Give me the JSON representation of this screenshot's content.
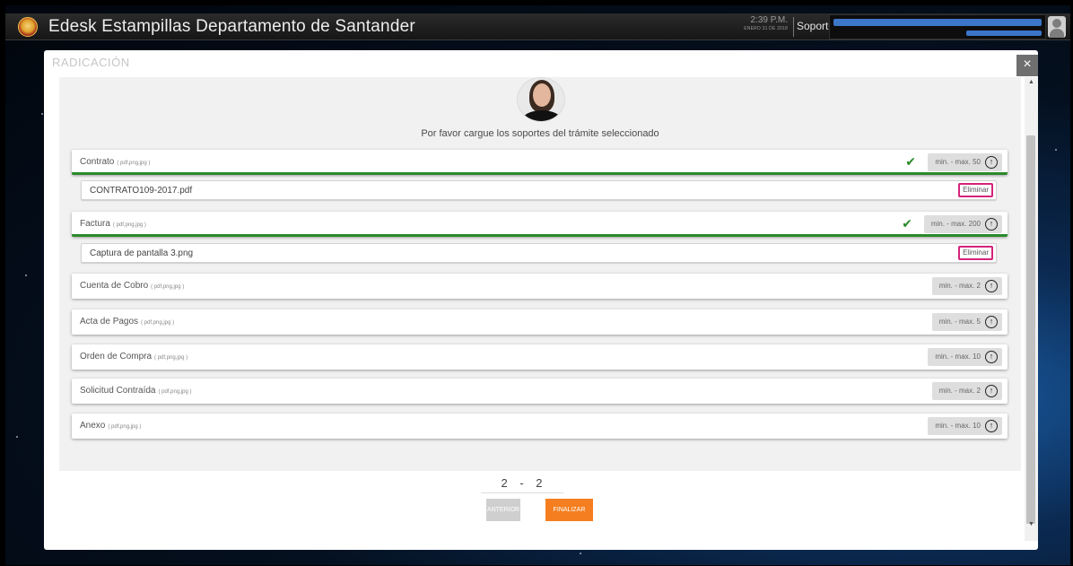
{
  "app": {
    "title": "Edesk Estampillas Departamento de Santander",
    "time": "2:39 P.M.",
    "date": "ENERO 31 DE 2018",
    "user_label": "Soporte"
  },
  "modal": {
    "title": "RADICACIÓN",
    "close": "×",
    "instruction": "Por favor cargue los soportes del trámite seleccionado"
  },
  "documents": [
    {
      "label": "Contrato",
      "ext": "( pdf,png,jpg )",
      "limit": "min. - max. 50",
      "done": true,
      "file": "CONTRATO109-2017.pdf",
      "delete": "Eliminar"
    },
    {
      "label": "Factura",
      "ext": "( pdf,png,jpg )",
      "limit": "min. - max. 200",
      "done": true,
      "file": "Captura de pantalla 3.png",
      "delete": "Eliminar"
    },
    {
      "label": "Cuenta de Cobro",
      "ext": "( pdf,png,jpg )",
      "limit": "min. - max. 2",
      "done": false
    },
    {
      "label": "Acta de Pagos",
      "ext": "( pdf,png,jpg )",
      "limit": "min. - max. 5",
      "done": false
    },
    {
      "label": "Orden de Compra",
      "ext": "( pdf,png,jpg )",
      "limit": "min. - max. 10",
      "done": false
    },
    {
      "label": "Solicitud Contraída",
      "ext": "( pdf,png,jpg )",
      "limit": "min. - max. 2",
      "done": false
    },
    {
      "label": "Anexo",
      "ext": "( pdf,png,jpg )",
      "limit": "min. - max. 10",
      "done": false
    }
  ],
  "pager": {
    "current": "2",
    "separator": "-",
    "total": "2"
  },
  "buttons": {
    "prev": "ANTERIOR",
    "finish": "FINALIZAR"
  },
  "icons": {
    "check": "check-icon",
    "upload": "upload-arrow-icon",
    "close": "close-icon"
  },
  "colors": {
    "success": "#2a8a2a",
    "accent": "#f57f20",
    "delete_border": "#d4237a"
  }
}
